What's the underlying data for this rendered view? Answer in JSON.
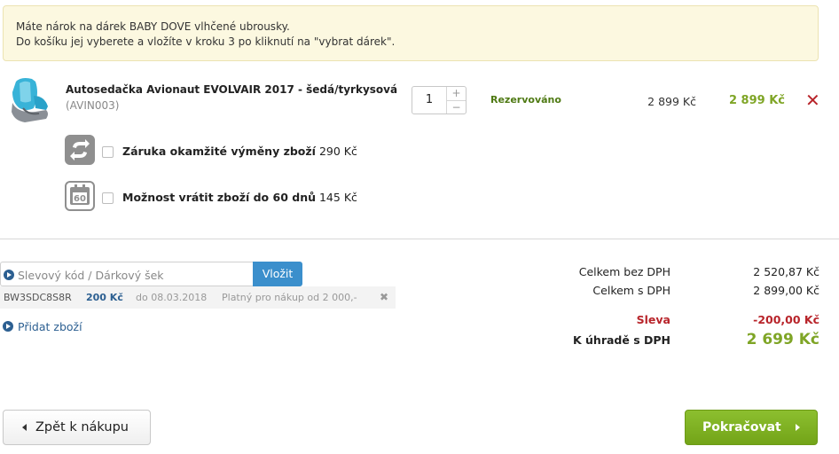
{
  "notice": {
    "line1": "Máte nárok na dárek BABY DOVE vlhčené ubrousky.",
    "line2": "Do košíku jej vyberete a vložíte v kroku 3 po kliknutí na \"vybrat dárek\"."
  },
  "product": {
    "name": "Autosedačka Avionaut EVOLVAIR 2017 - šedá/tyrkysová",
    "code": "(AVIN003)",
    "quantity": "1",
    "qty_plus": "+",
    "qty_minus": "−",
    "status": "Rezervováno",
    "unit_price": "2 899 Kč",
    "total_price": "2 899 Kč",
    "remove": "✕"
  },
  "services": [
    {
      "name": "Záruka okamžité výměny zboží",
      "price": "290 Kč",
      "icon": "exchange-icon"
    },
    {
      "name": "Možnost vrátit zboží do 60 dnů",
      "price": "145 Kč",
      "icon": "calendar-60-icon",
      "icon_text": "60"
    }
  ],
  "coupon": {
    "placeholder": "Slevový kód / Dárkový šek",
    "apply_label": "Vložit",
    "applied": {
      "code": "BW3SDC8S8R",
      "amount": "200 Kč",
      "valid": "do 08.03.2018",
      "condition": "Platný pro nákup od 2 000,-",
      "remove": "✖"
    }
  },
  "add_items_label": "Přidat zboží",
  "summary": {
    "without_vat_label": "Celkem bez DPH",
    "without_vat_value": "2 520,87 Kč",
    "with_vat_label": "Celkem s DPH",
    "with_vat_value": "2 899,00 Kč",
    "discount_label": "Sleva",
    "discount_value": "-200,00 Kč",
    "total_label": "K úhradě s DPH",
    "total_value": "2 699 Kč"
  },
  "buttons": {
    "back": "Zpět k nákupu",
    "next": "Pokračovat"
  },
  "colors": {
    "accent_green": "#7fa526",
    "link_blue": "#2c5f91",
    "discount_red": "#b8242a",
    "notice_bg": "#fcf8e0"
  }
}
